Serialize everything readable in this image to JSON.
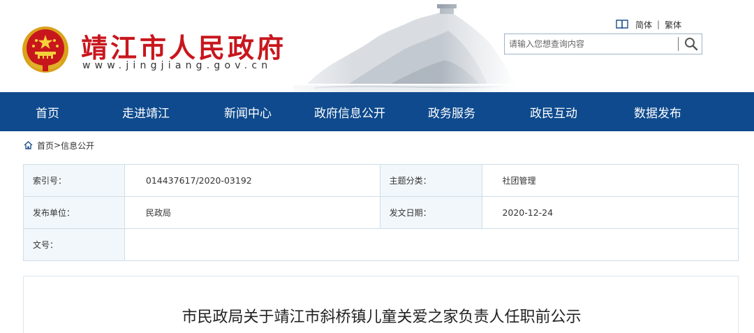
{
  "header": {
    "site_title": "靖江市人民政府",
    "site_url": "www.jingjiang.gov.cn",
    "lang_simplified": "简体",
    "lang_separator": "|",
    "lang_traditional": "繁体",
    "search_placeholder": "请输入您想查询内容"
  },
  "colors": {
    "title_red": "#c8161d",
    "nav_blue": "#0e4a8d",
    "table_label_bg": "#f2f7fb",
    "table_border": "#cfdde8"
  },
  "icons": {
    "emblem": "national-emblem-icon",
    "book": "book-icon",
    "search": "search-icon",
    "home": "home-icon"
  },
  "nav": {
    "items": [
      {
        "label": "首页"
      },
      {
        "label": "走进靖江"
      },
      {
        "label": "新闻中心"
      },
      {
        "label": "政府信息公开"
      },
      {
        "label": "政务服务"
      },
      {
        "label": "政民互动"
      },
      {
        "label": "数据发布"
      }
    ]
  },
  "breadcrumb": {
    "home": "首页",
    "separator": ">",
    "current": "信息公开"
  },
  "info": {
    "index_label": "索引号：",
    "index_value": "014437617/2020-03192",
    "topic_label": "主题分类：",
    "topic_value": "社团管理",
    "publisher_label": "发布单位：",
    "publisher_value": "民政局",
    "date_label": "发文日期：",
    "date_value": "2020-12-24",
    "doc_no_label": "文号：",
    "doc_no_value": ""
  },
  "article": {
    "title": "市民政局关于靖江市斜桥镇儿童关爱之家负责人任职前公示"
  }
}
